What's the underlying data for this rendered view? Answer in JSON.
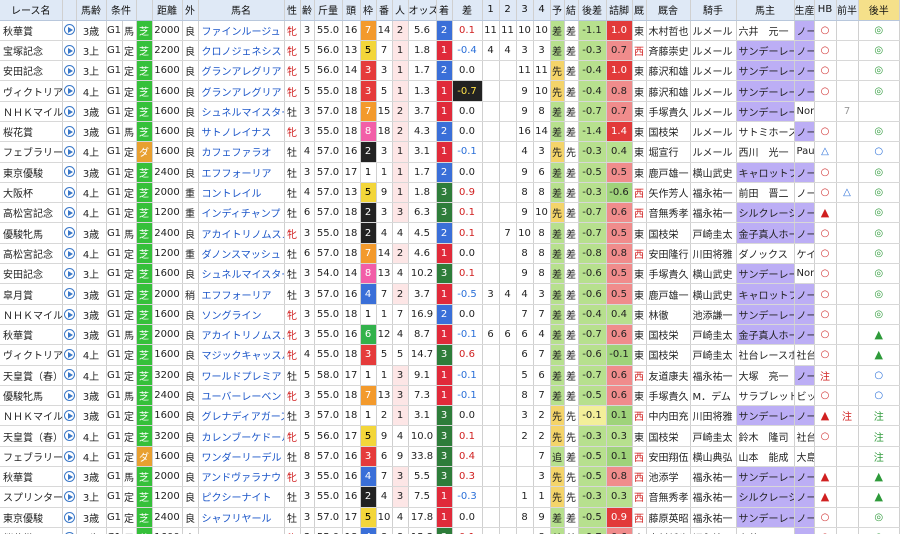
{
  "headers": [
    "レース名",
    "馬齢",
    "条件",
    "",
    "距離",
    "外",
    "",
    "馬名",
    "性",
    "齢",
    "斤量",
    "頭",
    "枠",
    "番",
    "人",
    "オッズ",
    "着",
    "差",
    "1",
    "2",
    "3",
    "4",
    "予",
    "結",
    "後差",
    "詰脚",
    "厩",
    "騎手",
    "馬主",
    "生産",
    "HB",
    "前半",
    "後半"
  ],
  "rows": [
    {
      "race": "秋華賞",
      "age": "3歳",
      "grade": "G1",
      "cond": "馬",
      "surface": "芝",
      "dist": "2000",
      "track": "良",
      "horse": "ファインルージュ",
      "sex": "牝",
      "hage": "3",
      "wt": "55.0",
      "fld": "16",
      "waku": "7",
      "num": "14",
      "pop": "2",
      "odds": "5.6",
      "fin": "2",
      "diff": "0.1",
      "c1": "11",
      "c2": "11",
      "c3": "10",
      "c4": "10",
      "yo": "差",
      "res": "差",
      "ldiff": "-1.1",
      "agari": "1.0",
      "stable": "東",
      "trainer": "木村哲也",
      "jockey": "ルメール",
      "owner": "六井　元一",
      "owner_hl": false,
      "breeder": "ノーザンファ",
      "hb": "○",
      "h1": "",
      "h2": "◎"
    },
    {
      "race": "宝塚記念",
      "age": "3上",
      "grade": "G1",
      "cond": "定",
      "surface": "芝",
      "dist": "2200",
      "track": "良",
      "horse": "クロノジェネシス",
      "sex": "牝",
      "hage": "5",
      "wt": "56.0",
      "fld": "13",
      "waku": "5",
      "num": "7",
      "pop": "1",
      "odds": "1.8",
      "fin": "1",
      "diff": "-0.4",
      "c1": "4",
      "c2": "4",
      "c3": "3",
      "c4": "3",
      "yo": "差",
      "res": "差",
      "ldiff": "-0.3",
      "agari": "0.7",
      "stable": "西",
      "trainer": "斉藤崇史",
      "jockey": "ルメール",
      "owner": "サンデーレー",
      "owner_hl": true,
      "breeder": "ノーザンファ",
      "hb": "○",
      "h1": "",
      "h2": "◎"
    },
    {
      "race": "安田記念",
      "age": "3上",
      "grade": "G1",
      "cond": "定",
      "surface": "芝",
      "dist": "1600",
      "track": "良",
      "horse": "グランアレグリア",
      "sex": "牝",
      "hage": "5",
      "wt": "56.0",
      "fld": "14",
      "waku": "3",
      "num": "3",
      "pop": "1",
      "odds": "1.7",
      "fin": "2",
      "diff": "0.0",
      "c1": "",
      "c2": "",
      "c3": "11",
      "c4": "11",
      "yo": "先",
      "res": "差",
      "ldiff": "-0.4",
      "agari": "1.0",
      "stable": "東",
      "trainer": "藤沢和雄",
      "jockey": "ルメール",
      "owner": "サンデーレー",
      "owner_hl": true,
      "breeder": "ノーザンファ",
      "hb": "○",
      "h1": "",
      "h2": "◎"
    },
    {
      "race": "ヴィクトリア",
      "age": "4上",
      "grade": "G1",
      "cond": "定",
      "surface": "芝",
      "dist": "1600",
      "track": "良",
      "horse": "グランアレグリア",
      "sex": "牝",
      "hage": "5",
      "wt": "55.0",
      "fld": "18",
      "waku": "3",
      "num": "5",
      "pop": "1",
      "odds": "1.3",
      "fin": "1",
      "diff": "-0.7",
      "c1": "",
      "c2": "",
      "c3": "9",
      "c4": "10",
      "yo": "先",
      "res": "差",
      "ldiff": "-0.4",
      "agari": "0.8",
      "stable": "東",
      "trainer": "藤沢和雄",
      "jockey": "ルメール",
      "owner": "サンデーレー",
      "owner_hl": true,
      "breeder": "ノーザンファ",
      "hb": "○",
      "h1": "",
      "h2": "◎"
    },
    {
      "race": "ＮＨＫマイル",
      "age": "3歳",
      "grade": "G1",
      "cond": "定",
      "surface": "芝",
      "dist": "1600",
      "track": "良",
      "horse": "シュネルマイスター",
      "sex": "牡",
      "hage": "3",
      "wt": "57.0",
      "fld": "18",
      "waku": "7",
      "num": "15",
      "pop": "2",
      "odds": "3.7",
      "fin": "1",
      "diff": "0.0",
      "c1": "",
      "c2": "",
      "c3": "9",
      "c4": "8",
      "yo": "差",
      "res": "差",
      "ldiff": "-0.7",
      "agari": "0.7",
      "stable": "東",
      "trainer": "手塚貴久",
      "jockey": "ルメール",
      "owner": "サンデーレー",
      "owner_hl": true,
      "breeder": "Northe",
      "hb": "",
      "h1": "7",
      "h2": ""
    },
    {
      "race": "桜花賞",
      "age": "3歳",
      "grade": "G1",
      "cond": "馬",
      "surface": "芝",
      "dist": "1600",
      "track": "良",
      "horse": "サトノレイナス",
      "sex": "牝",
      "hage": "3",
      "wt": "55.0",
      "fld": "18",
      "waku": "8",
      "num": "18",
      "pop": "2",
      "odds": "4.3",
      "fin": "2",
      "diff": "0.0",
      "c1": "",
      "c2": "",
      "c3": "16",
      "c4": "14",
      "yo": "差",
      "res": "差",
      "ldiff": "-1.4",
      "agari": "1.4",
      "stable": "東",
      "trainer": "国枝栄",
      "jockey": "ルメール",
      "owner": "サトミホース",
      "owner_hl": false,
      "breeder": "ノーザンファ",
      "hb": "○",
      "h1": "",
      "h2": "◎"
    },
    {
      "race": "フェブラリー",
      "age": "4上",
      "grade": "G1",
      "cond": "定",
      "surface": "ダ",
      "dist": "1600",
      "track": "良",
      "horse": "カフェファラオ",
      "sex": "牡",
      "hage": "4",
      "wt": "57.0",
      "fld": "16",
      "waku": "2",
      "num": "3",
      "pop": "1",
      "odds": "3.1",
      "fin": "1",
      "diff": "-0.1",
      "c1": "",
      "c2": "",
      "c3": "4",
      "c4": "3",
      "yo": "先",
      "res": "先",
      "ldiff": "-0.3",
      "agari": "0.4",
      "stable": "東",
      "trainer": "堀宣行",
      "jockey": "ルメール",
      "owner": "西川　光一",
      "owner_hl": false,
      "breeder": "Paul P",
      "hb": "△",
      "h1": "",
      "h2": "○"
    },
    {
      "race": "東京優駿",
      "age": "3歳",
      "grade": "G1",
      "cond": "定",
      "surface": "芝",
      "dist": "2400",
      "track": "良",
      "horse": "エフフォーリア",
      "sex": "牡",
      "hage": "3",
      "wt": "57.0",
      "fld": "17",
      "waku": "1",
      "num": "1",
      "pop": "1",
      "odds": "1.7",
      "fin": "2",
      "diff": "0.0",
      "c1": "",
      "c2": "",
      "c3": "9",
      "c4": "6",
      "yo": "差",
      "res": "差",
      "ldiff": "-0.5",
      "agari": "0.5",
      "stable": "東",
      "trainer": "鹿戸雄一",
      "jockey": "横山武史",
      "owner": "キャロットフ",
      "owner_hl": true,
      "breeder": "ノーザンファ",
      "hb": "○",
      "h1": "",
      "h2": "◎"
    },
    {
      "race": "大阪杯",
      "age": "4上",
      "grade": "G1",
      "cond": "定",
      "surface": "芝",
      "dist": "2000",
      "track": "重",
      "horse": "コントレイル",
      "sex": "牡",
      "hage": "4",
      "wt": "57.0",
      "fld": "13",
      "waku": "5",
      "num": "9",
      "pop": "1",
      "odds": "1.8",
      "fin": "3",
      "diff": "0.9",
      "c1": "",
      "c2": "",
      "c3": "8",
      "c4": "8",
      "yo": "差",
      "res": "差",
      "ldiff": "-0.3",
      "agari": "-0.6",
      "stable": "西",
      "trainer": "矢作芳人",
      "jockey": "福永祐一",
      "owner": "前田　晋二",
      "owner_hl": false,
      "breeder": "ノースヒルズ",
      "hb": "○",
      "h1": "△",
      "h2": "◎"
    },
    {
      "race": "高松宮記念",
      "age": "4上",
      "grade": "G1",
      "cond": "定",
      "surface": "芝",
      "dist": "1200",
      "track": "重",
      "horse": "インディチャンプ",
      "sex": "牡",
      "hage": "6",
      "wt": "57.0",
      "fld": "18",
      "waku": "2",
      "num": "3",
      "pop": "3",
      "odds": "6.3",
      "fin": "3",
      "diff": "0.1",
      "c1": "",
      "c2": "",
      "c3": "9",
      "c4": "10",
      "yo": "先",
      "res": "差",
      "ldiff": "-0.7",
      "agari": "0.6",
      "stable": "西",
      "trainer": "音無秀孝",
      "jockey": "福永祐一",
      "owner": "シルクレーシ",
      "owner_hl": true,
      "breeder": "ノーザンファ",
      "hb": "▲",
      "h1": "",
      "h2": "◎"
    },
    {
      "race": "優駿牝馬",
      "age": "3歳",
      "grade": "G1",
      "cond": "馬",
      "surface": "芝",
      "dist": "2400",
      "track": "良",
      "horse": "アカイトリノムスメ",
      "sex": "牝",
      "hage": "3",
      "wt": "55.0",
      "fld": "18",
      "waku": "2",
      "num": "4",
      "pop": "4",
      "odds": "4.5",
      "fin": "2",
      "diff": "0.1",
      "c1": "",
      "c2": "7",
      "c3": "10",
      "c4": "8",
      "yo": "差",
      "res": "差",
      "ldiff": "-0.7",
      "agari": "0.5",
      "stable": "東",
      "trainer": "国枝栄",
      "jockey": "戸崎圭太",
      "owner": "金子真人ホー",
      "owner_hl": true,
      "breeder": "ノーザンファ",
      "hb": "○",
      "h1": "",
      "h2": "◎"
    },
    {
      "race": "高松宮記念",
      "age": "4上",
      "grade": "G1",
      "cond": "定",
      "surface": "芝",
      "dist": "1200",
      "track": "重",
      "horse": "ダノンスマッシュ",
      "sex": "牡",
      "hage": "6",
      "wt": "57.0",
      "fld": "18",
      "waku": "7",
      "num": "14",
      "pop": "2",
      "odds": "4.6",
      "fin": "1",
      "diff": "0.0",
      "c1": "",
      "c2": "",
      "c3": "8",
      "c4": "8",
      "yo": "差",
      "res": "差",
      "ldiff": "-0.8",
      "agari": "0.8",
      "stable": "西",
      "trainer": "安田隆行",
      "jockey": "川田将雅",
      "owner": "ダノックス",
      "owner_hl": false,
      "breeder": "ケイアイファ",
      "hb": "○",
      "h1": "",
      "h2": "◎"
    },
    {
      "race": "安田記念",
      "age": "3上",
      "grade": "G1",
      "cond": "定",
      "surface": "芝",
      "dist": "1600",
      "track": "良",
      "horse": "シュネルマイスター",
      "sex": "牡",
      "hage": "3",
      "wt": "54.0",
      "fld": "14",
      "waku": "8",
      "num": "13",
      "pop": "4",
      "odds": "10.2",
      "fin": "3",
      "diff": "0.1",
      "c1": "",
      "c2": "",
      "c3": "9",
      "c4": "8",
      "yo": "差",
      "res": "差",
      "ldiff": "-0.6",
      "agari": "0.5",
      "stable": "東",
      "trainer": "手塚貴久",
      "jockey": "横山武史",
      "owner": "サンデーレー",
      "owner_hl": true,
      "breeder": "Northe",
      "hb": "○",
      "h1": "",
      "h2": "◎"
    },
    {
      "race": "皐月賞",
      "age": "3歳",
      "grade": "G1",
      "cond": "定",
      "surface": "芝",
      "dist": "2000",
      "track": "稍",
      "horse": "エフフォーリア",
      "sex": "牡",
      "hage": "3",
      "wt": "57.0",
      "fld": "16",
      "waku": "4",
      "num": "7",
      "pop": "2",
      "odds": "3.7",
      "fin": "1",
      "diff": "-0.5",
      "c1": "3",
      "c2": "4",
      "c3": "4",
      "c4": "3",
      "yo": "差",
      "res": "差",
      "ldiff": "-0.6",
      "agari": "0.5",
      "stable": "東",
      "trainer": "鹿戸雄一",
      "jockey": "横山武史",
      "owner": "キャロットフ",
      "owner_hl": true,
      "breeder": "ノーザンファ",
      "hb": "○",
      "h1": "",
      "h2": "◎"
    },
    {
      "race": "ＮＨＫマイル",
      "age": "3歳",
      "grade": "G1",
      "cond": "定",
      "surface": "芝",
      "dist": "1600",
      "track": "良",
      "horse": "ソングライン",
      "sex": "牝",
      "hage": "3",
      "wt": "55.0",
      "fld": "18",
      "waku": "1",
      "num": "1",
      "pop": "7",
      "odds": "16.9",
      "fin": "2",
      "diff": "0.0",
      "c1": "",
      "c2": "",
      "c3": "7",
      "c4": "7",
      "yo": "差",
      "res": "差",
      "ldiff": "-0.4",
      "agari": "0.4",
      "stable": "東",
      "trainer": "林徹",
      "jockey": "池添謙一",
      "owner": "サンデーレー",
      "owner_hl": true,
      "breeder": "ノーザンファ",
      "hb": "○",
      "h1": "",
      "h2": "◎"
    },
    {
      "race": "秋華賞",
      "age": "3歳",
      "grade": "G1",
      "cond": "馬",
      "surface": "芝",
      "dist": "2000",
      "track": "良",
      "horse": "アカイトリノムスメ",
      "sex": "牝",
      "hage": "3",
      "wt": "55.0",
      "fld": "16",
      "waku": "6",
      "num": "12",
      "pop": "4",
      "odds": "8.7",
      "fin": "1",
      "diff": "-0.1",
      "c1": "6",
      "c2": "6",
      "c3": "6",
      "c4": "4",
      "yo": "差",
      "res": "差",
      "ldiff": "-0.7",
      "agari": "0.6",
      "stable": "東",
      "trainer": "国枝栄",
      "jockey": "戸崎圭太",
      "owner": "金子真人ホー",
      "owner_hl": true,
      "breeder": "ノーザンファ",
      "hb": "○",
      "h1": "",
      "h2": "▲"
    },
    {
      "race": "ヴィクトリア",
      "age": "4上",
      "grade": "G1",
      "cond": "定",
      "surface": "芝",
      "dist": "1600",
      "track": "良",
      "horse": "マジックキャッスル",
      "sex": "牝",
      "hage": "4",
      "wt": "55.0",
      "fld": "18",
      "waku": "3",
      "num": "5",
      "pop": "5",
      "odds": "14.7",
      "fin": "3",
      "diff": "0.6",
      "c1": "",
      "c2": "",
      "c3": "6",
      "c4": "7",
      "yo": "差",
      "res": "差",
      "ldiff": "-0.6",
      "agari": "-0.1",
      "stable": "東",
      "trainer": "国枝栄",
      "jockey": "戸崎圭太",
      "owner": "社台レースホ",
      "owner_hl": false,
      "breeder": "社台ファーム",
      "hb": "○",
      "h1": "",
      "h2": "▲"
    },
    {
      "race": "天皇賞（春）",
      "age": "4上",
      "grade": "G1",
      "cond": "定",
      "surface": "芝",
      "dist": "3200",
      "track": "良",
      "horse": "ワールドプレミア",
      "sex": "牡",
      "hage": "5",
      "wt": "58.0",
      "fld": "17",
      "waku": "1",
      "num": "1",
      "pop": "3",
      "odds": "9.1",
      "fin": "1",
      "diff": "-0.1",
      "c1": "",
      "c2": "",
      "c3": "5",
      "c4": "6",
      "yo": "差",
      "res": "差",
      "ldiff": "-0.7",
      "agari": "0.6",
      "stable": "西",
      "trainer": "友道康夫",
      "jockey": "福永祐一",
      "owner": "大塚　亮一",
      "owner_hl": false,
      "breeder": "ノーザンファ",
      "hb": "注",
      "h1": "",
      "h2": "○"
    },
    {
      "race": "優駿牝馬",
      "age": "3歳",
      "grade": "G1",
      "cond": "馬",
      "surface": "芝",
      "dist": "2400",
      "track": "良",
      "horse": "ユーバーレーベン",
      "sex": "牝",
      "hage": "3",
      "wt": "55.0",
      "fld": "18",
      "waku": "7",
      "num": "13",
      "pop": "3",
      "odds": "7.3",
      "fin": "1",
      "diff": "-0.1",
      "c1": "",
      "c2": "",
      "c3": "8",
      "c4": "7",
      "yo": "差",
      "res": "差",
      "ldiff": "-0.5",
      "agari": "0.6",
      "stable": "東",
      "trainer": "手塚貴久",
      "jockey": "M．デム",
      "owner": "サラブレッド",
      "owner_hl": false,
      "breeder": "ビッグレッド",
      "hb": "○",
      "h1": "",
      "h2": "○"
    },
    {
      "race": "ＮＨＫマイル",
      "age": "3歳",
      "grade": "G1",
      "cond": "定",
      "surface": "芝",
      "dist": "1600",
      "track": "良",
      "horse": "グレナディアガーズ",
      "sex": "牡",
      "hage": "3",
      "wt": "57.0",
      "fld": "18",
      "waku": "1",
      "num": "2",
      "pop": "1",
      "odds": "3.1",
      "fin": "3",
      "diff": "0.0",
      "c1": "",
      "c2": "",
      "c3": "3",
      "c4": "2",
      "yo": "先",
      "res": "先",
      "ldiff": "-0.1",
      "agari": "0.1",
      "stable": "西",
      "trainer": "中内田充",
      "jockey": "川田将雅",
      "owner": "サンデーレー",
      "owner_hl": true,
      "breeder": "ノーザンファ",
      "hb": "▲",
      "h1": "注",
      "h2": "注"
    },
    {
      "race": "天皇賞（春）",
      "age": "4上",
      "grade": "G1",
      "cond": "定",
      "surface": "芝",
      "dist": "3200",
      "track": "良",
      "horse": "カレンブーケドール",
      "sex": "牝",
      "hage": "5",
      "wt": "56.0",
      "fld": "17",
      "waku": "5",
      "num": "9",
      "pop": "4",
      "odds": "10.0",
      "fin": "3",
      "diff": "0.1",
      "c1": "",
      "c2": "",
      "c3": "2",
      "c4": "2",
      "yo": "先",
      "res": "先",
      "ldiff": "-0.3",
      "agari": "0.3",
      "stable": "東",
      "trainer": "国枝栄",
      "jockey": "戸崎圭太",
      "owner": "鈴木　隆司",
      "owner_hl": false,
      "breeder": "社台ファーム",
      "hb": "○",
      "h1": "",
      "h2": "注"
    },
    {
      "race": "フェブラリー",
      "age": "4上",
      "grade": "G1",
      "cond": "定",
      "surface": "ダ",
      "dist": "1600",
      "track": "良",
      "horse": "ワンダーリーデル",
      "sex": "牡",
      "hage": "8",
      "wt": "57.0",
      "fld": "16",
      "waku": "3",
      "num": "6",
      "pop": "9",
      "odds": "33.8",
      "fin": "3",
      "diff": "0.4",
      "c1": "",
      "c2": "",
      "c3": "",
      "c4": "7",
      "yo": "追",
      "res": "差",
      "ldiff": "-0.5",
      "agari": "0.1",
      "stable": "西",
      "trainer": "安田翔伍",
      "jockey": "横山典弘",
      "owner": "山本　能成",
      "owner_hl": false,
      "breeder": "大島牧場",
      "hb": "",
      "h1": "",
      "h2": "注"
    },
    {
      "race": "秋華賞",
      "age": "3歳",
      "grade": "G1",
      "cond": "馬",
      "surface": "芝",
      "dist": "2000",
      "track": "良",
      "horse": "アンドヴァラナウト",
      "sex": "牝",
      "hage": "3",
      "wt": "55.0",
      "fld": "16",
      "waku": "4",
      "num": "7",
      "pop": "3",
      "odds": "5.5",
      "fin": "3",
      "diff": "0.3",
      "c1": "",
      "c2": "",
      "c3": "",
      "c4": "3",
      "yo": "先",
      "res": "先",
      "ldiff": "-0.5",
      "agari": "0.8",
      "stable": "西",
      "trainer": "池添学",
      "jockey": "福永祐一",
      "owner": "サンデーレー",
      "owner_hl": true,
      "breeder": "ノーザンファ",
      "hb": "▲",
      "h1": "",
      "h2": "▲"
    },
    {
      "race": "スプリンター",
      "age": "3上",
      "grade": "G1",
      "cond": "定",
      "surface": "芝",
      "dist": "1200",
      "track": "良",
      "horse": "ピクシーナイト",
      "sex": "牡",
      "hage": "3",
      "wt": "55.0",
      "fld": "16",
      "waku": "2",
      "num": "4",
      "pop": "3",
      "odds": "7.5",
      "fin": "1",
      "diff": "-0.3",
      "c1": "",
      "c2": "",
      "c3": "1",
      "c4": "1",
      "yo": "先",
      "res": "先",
      "ldiff": "-0.3",
      "agari": "0.3",
      "stable": "西",
      "trainer": "音無秀孝",
      "jockey": "福永祐一",
      "owner": "シルクレーシ",
      "owner_hl": true,
      "breeder": "ノーザンファ",
      "hb": "▲",
      "h1": "",
      "h2": "▲"
    },
    {
      "race": "東京優駿",
      "age": "3歳",
      "grade": "G1",
      "cond": "定",
      "surface": "芝",
      "dist": "2400",
      "track": "良",
      "horse": "シャフリヤール",
      "sex": "牡",
      "hage": "3",
      "wt": "57.0",
      "fld": "17",
      "waku": "5",
      "num": "10",
      "pop": "4",
      "odds": "17.8",
      "fin": "1",
      "diff": "0.0",
      "c1": "",
      "c2": "",
      "c3": "8",
      "c4": "9",
      "yo": "差",
      "res": "差",
      "ldiff": "-0.5",
      "agari": "0.9",
      "stable": "西",
      "trainer": "藤原英昭",
      "jockey": "福永祐一",
      "owner": "サンデーレー",
      "owner_hl": true,
      "breeder": "ノーザンファ",
      "hb": "○",
      "h1": "",
      "h2": "◎"
    },
    {
      "race": "桜花賞",
      "age": "3歳",
      "grade": "G1",
      "cond": "馬",
      "surface": "芝",
      "dist": "1600",
      "track": "良",
      "horse": "ファインルージュ",
      "sex": "牝",
      "hage": "3",
      "wt": "55.0",
      "fld": "18",
      "waku": "4",
      "num": "8",
      "pop": "8",
      "odds": "15.3",
      "fin": "3",
      "diff": "0.1",
      "c1": "",
      "c2": "",
      "c3": "",
      "c4": "8",
      "yo": "差",
      "res": "差",
      "ldiff": "-0.7",
      "agari": "0.6",
      "stable": "東",
      "trainer": "木村哲也",
      "jockey": "福永祐一",
      "owner": "六井　元一",
      "owner_hl": false,
      "breeder": "ノーザンファ",
      "hb": "○",
      "h1": "",
      "h2": "◎"
    }
  ]
}
